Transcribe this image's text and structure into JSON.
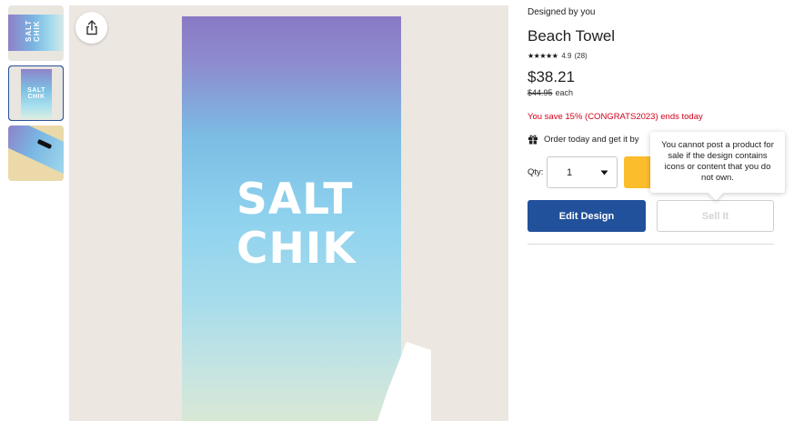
{
  "product": {
    "designed_by": "Designed by you",
    "title": "Beach Towel",
    "stars": "★★★★★",
    "rating": "4.9",
    "reviews": "(28)",
    "price": "$38.21",
    "old_price": "$44.95",
    "price_unit": "each",
    "promo": "You save 15% (CONGRATS2023) ends today",
    "delivery": "Order today and get it by"
  },
  "towel": {
    "line1": "SALT",
    "line2": "CHIK"
  },
  "thumbnails": {
    "thumb1_text": "SALT CHIK",
    "thumb2_line1": "SALT",
    "thumb2_line2": "CHIK"
  },
  "purchase": {
    "qty_label": "Qty:",
    "qty_value": "1",
    "edit_label": "Edit Design",
    "sell_label": "Sell It"
  },
  "tooltip": {
    "text": "You cannot post a product for sale if the design contains icons or content that you do not own."
  },
  "colors": {
    "primary_button": "#22519b",
    "cart_button": "#fbbd2c",
    "promo_text": "#d0021b"
  },
  "icons": [
    "share-icon",
    "gift-icon",
    "chevron-down-icon"
  ]
}
